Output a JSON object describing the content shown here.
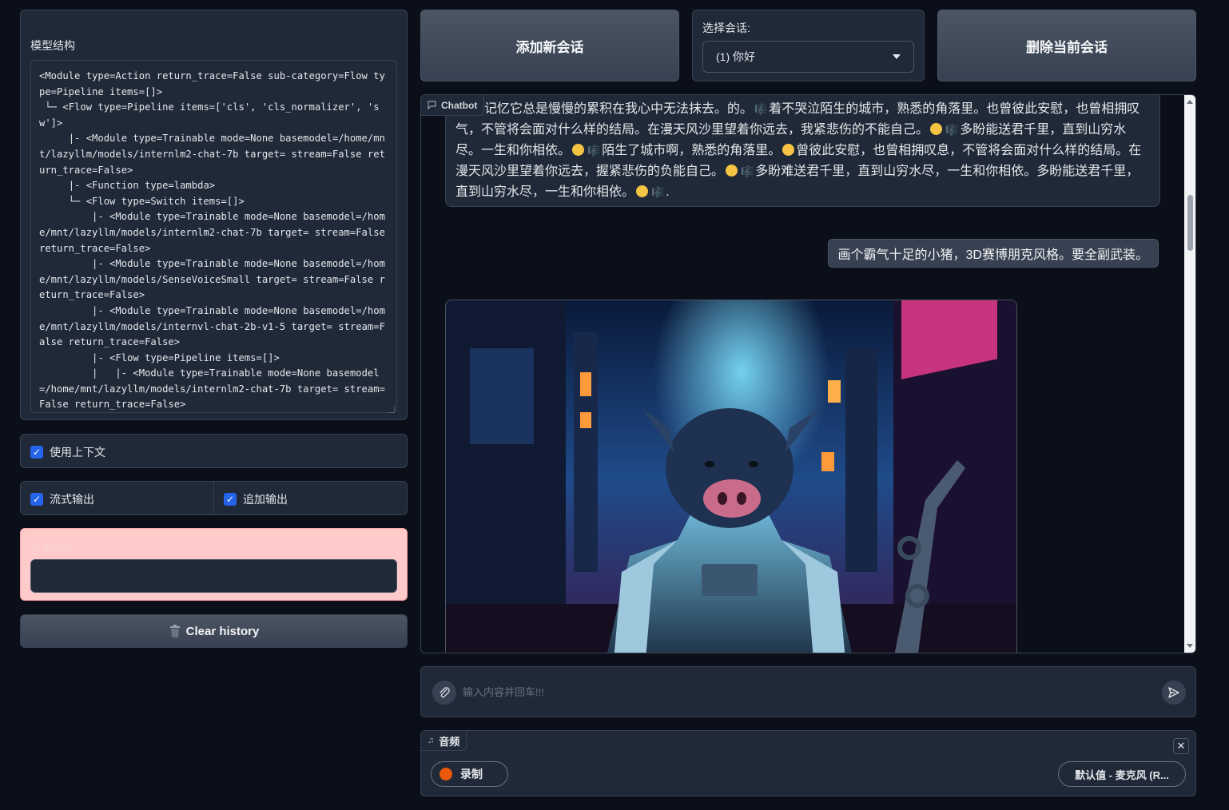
{
  "left": {
    "model_title": "模型结构",
    "model_code": "<Module type=Action return_trace=False sub-category=Flow type=Pipeline items=[]>\n └─ <Flow type=Pipeline items=['cls', 'cls_normalizer', 'sw']>\n     |- <Module type=Trainable mode=None basemodel=/home/mnt/lazyllm/models/internlm2-chat-7b target= stream=False return_trace=False>\n     |- <Function type=lambda>\n     └─ <Flow type=Switch items=[]>\n         |- <Module type=Trainable mode=None basemodel=/home/mnt/lazyllm/models/internlm2-chat-7b target= stream=False return_trace=False>\n         |- <Module type=Trainable mode=None basemodel=/home/mnt/lazyllm/models/SenseVoiceSmall target= stream=False return_trace=False>\n         |- <Module type=Trainable mode=None basemodel=/home/mnt/lazyllm/models/internvl-chat-2b-v1-5 target= stream=False return_trace=False>\n         |- <Flow type=Pipeline items=[]>\n         |   |- <Module type=Trainable mode=None basemodel=/home/mnt/lazyllm/models/internlm2-chat-7b target= stream=False return_trace=False>",
    "use_context_label": "使用上下文",
    "stream_output_label": "流式输出",
    "append_output_label": "追加输出",
    "log_label": "处理日志",
    "clear_history_label": "Clear history"
  },
  "top": {
    "add_session_label": "添加新会话",
    "select_session_label": "选择会话:",
    "selected_session": "(1) 你好",
    "delete_session_label": "删除当前会话"
  },
  "chat": {
    "tag_label": "Chatbot",
    "bot_text_1": "记忆它总是慢慢的累积在我心中无法抹去。的。",
    "bot_text_2": "着不哭泣陌生的城市，熟悉的角落里。也曾彼此安慰，也曾相拥叹气，不管将会面对什么样的结局。在漫天风沙里望着你远去，我紧悲伤的不能自己。",
    "bot_text_3": "多盼能送君千里，直到山穷水尽。一生和你相依。",
    "bot_text_4": "陌生了城市啊，熟悉的角落里。",
    "bot_text_5": "曾彼此安慰，也曾相拥叹息，不管将会面对什么样的结局。在漫天风沙里望着你远去，握紧悲伤的负能自己。",
    "bot_text_6": "多盼难送君千里，直到山穷水尽，一生和你相依。多盼能送君千里，直到山穷水尽，一生和你相依。",
    "bot_text_end": ".",
    "user_message": "画个霸气十足的小猪，3D赛博朋克风格。要全副武装。"
  },
  "input": {
    "placeholder": "输入内容并回车!!!"
  },
  "audio": {
    "tag_label": "音频",
    "record_label": "录制",
    "mic_label": "默认值 - 麦克风 (R..."
  },
  "colors": {
    "background": "#0b0f19",
    "panel": "#1f2937",
    "log_bg": "#fecaca",
    "checkbox": "#2563eb",
    "record_dot": "#ea580c"
  },
  "icons": [
    "trash-icon",
    "chat-icon",
    "paperclip-icon",
    "send-icon",
    "music-note-icon",
    "close-icon",
    "chevron-down-icon"
  ]
}
